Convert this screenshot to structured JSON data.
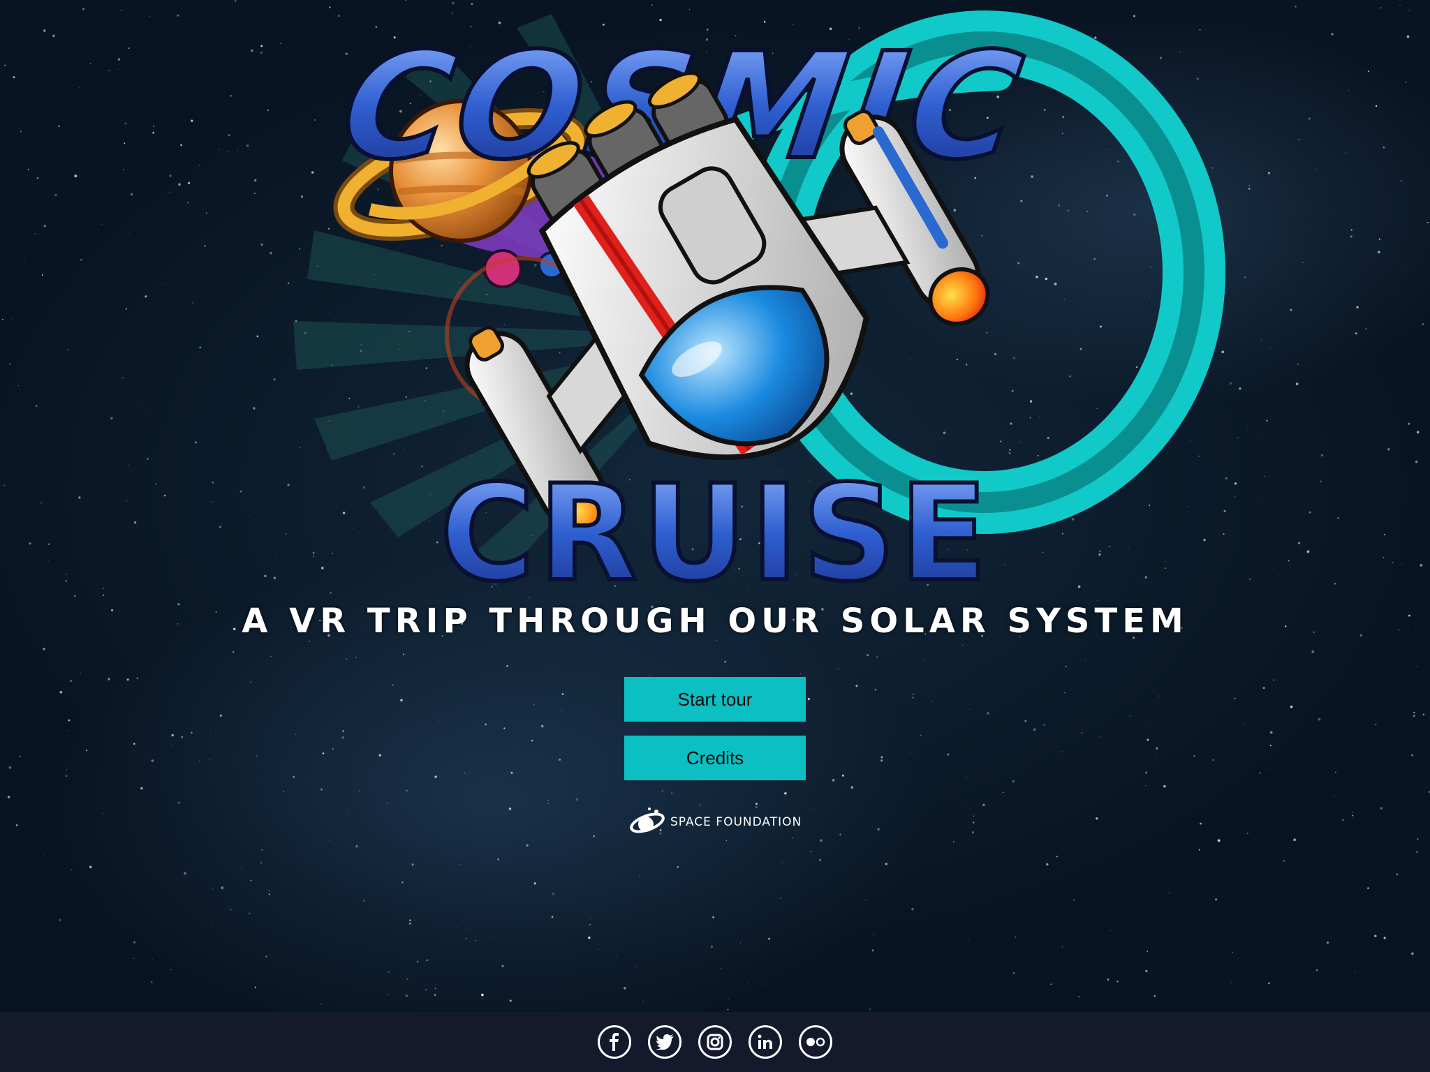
{
  "logo": {
    "title_top": "COSMIC",
    "title_bottom": "CRUISE"
  },
  "tagline": "A VR TRIP THROUGH OUR SOLAR SYSTEM",
  "buttons": {
    "start_label": "Start tour",
    "credits_label": "Credits"
  },
  "sponsor": {
    "name": "SPACE FOUNDATION",
    "icon": "space-foundation-logo-icon"
  },
  "footer": {
    "social": [
      "facebook-icon",
      "twitter-icon",
      "instagram-icon",
      "linkedin-icon",
      "flickr-icon"
    ]
  },
  "colors": {
    "button": "#0bbfc2",
    "footer": "#141a2c",
    "title_blue": "#2f5fd0",
    "swirl_teal": "#12c9c9"
  }
}
